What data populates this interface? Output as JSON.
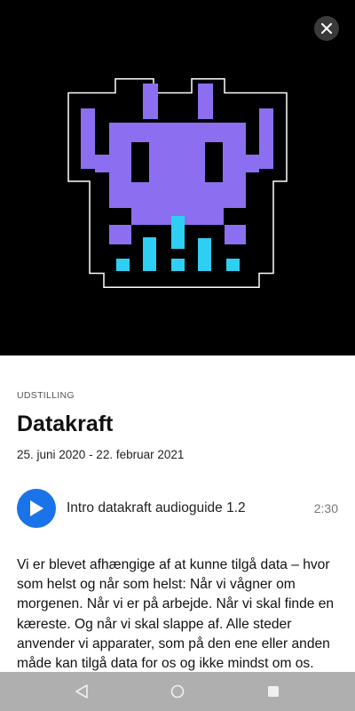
{
  "hero": {
    "close_icon": "close-icon",
    "image_icon": "pixel-invader-icon",
    "colors": {
      "background": "#000000",
      "purple": "#8c6ff0",
      "cyan": "#2ecff2",
      "outline": "#ffffff"
    }
  },
  "content": {
    "eyebrow": "UDSTILLING",
    "title": "Datakraft",
    "dates": "25. juni 2020 - 22. februar 2021"
  },
  "audio": {
    "play_icon": "play-icon",
    "track_title": "Intro datakraft audioguide 1.2",
    "duration": "2:30",
    "accent": "#1a73e8"
  },
  "body": {
    "text": "Vi er blevet afhængige af at kunne tilgå data – hvor som helst og når som helst: Når vi vågner om morgenen. Når vi er på arbejde. Når vi skal finde en kæreste. Og når vi skal slappe af. Alle steder anvender vi apparater, som på den ene eller anden måde kan tilgå data for os og ikke mindst om os."
  },
  "navbar": {
    "back_icon": "back-icon",
    "home_icon": "home-icon",
    "recents_icon": "recents-icon"
  }
}
